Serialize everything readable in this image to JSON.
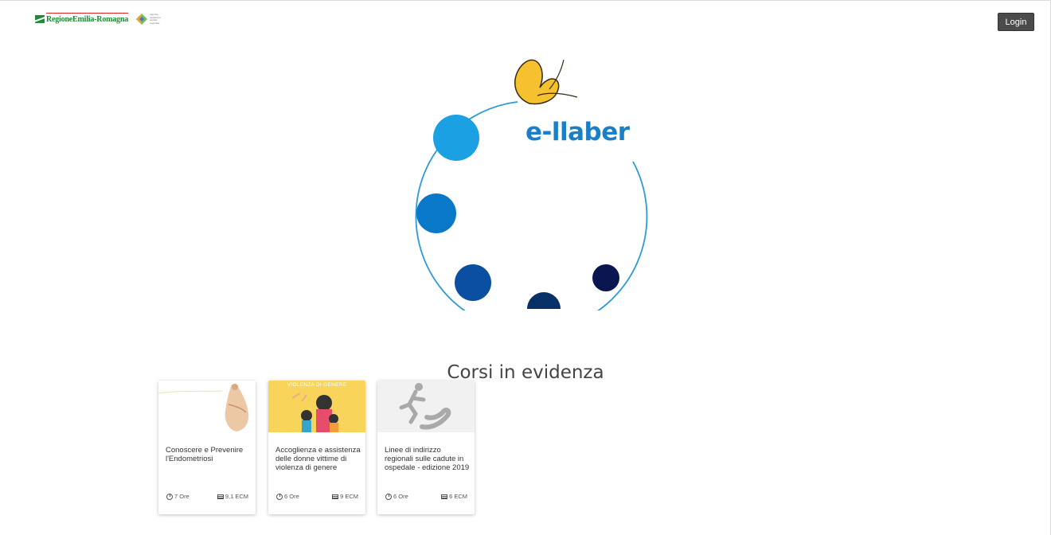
{
  "header": {
    "brand_text": "RegioneEmilia-Romagna",
    "agency_text": "agenzia sanitaria e sociale regionale",
    "login_label": "Login"
  },
  "logo": {
    "wordmark": "e-llaber"
  },
  "featured": {
    "title": "Corsi in evidenza",
    "courses": [
      {
        "title": "Conoscere e Prevenire l'Endometriosi",
        "hours": "7 Ore",
        "ecm": "9,1 ECM"
      },
      {
        "title": "Accoglienza e assistenza delle donne vittime di violenza di genere",
        "hours": "6 Ore",
        "ecm": "9 ECM",
        "image_caption": "VIOLENZA DI GENERE"
      },
      {
        "title": "Linee di indirizzo regionali sulle cadute in ospedale - edizione 2019",
        "hours": "6 Ore",
        "ecm": "6 ECM"
      }
    ]
  },
  "colors": {
    "login_bg": "#4b4b4b",
    "logo_blue": "#1a7fc7",
    "card2_bg": "#f8d45a"
  }
}
